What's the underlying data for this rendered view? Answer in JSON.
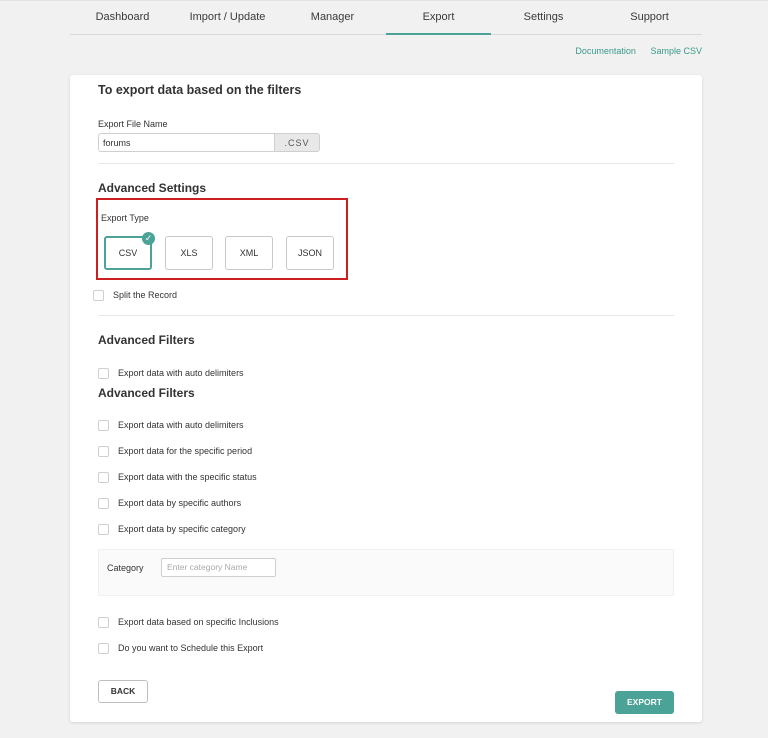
{
  "nav": {
    "tabs": [
      {
        "label": "Dashboard"
      },
      {
        "label": "Import / Update"
      },
      {
        "label": "Manager"
      },
      {
        "label": "Export"
      },
      {
        "label": "Settings"
      },
      {
        "label": "Support"
      }
    ],
    "active_tab": "Export"
  },
  "links": {
    "documentation": "Documentation",
    "sample_csv": "Sample CSV"
  },
  "card": {
    "title": "To export data based on the filters",
    "file_name_label": "Export File Name",
    "file_name_value": "forums",
    "file_ext": ".CSV",
    "advanced_settings_title": "Advanced Settings",
    "export_type_label": "Export Type",
    "export_types": [
      "CSV",
      "XLS",
      "XML",
      "JSON"
    ],
    "selected_type": "CSV",
    "split_record_label": "Split the Record",
    "advanced_filters_title_1": "Advanced Filters",
    "auto_delimiters_1": "Export data with auto delimiters",
    "advanced_filters_title_2": "Advanced Filters",
    "filters": [
      "Export data with auto delimiters",
      "Export data for the specific period",
      "Export data with the specific status",
      "Export data by specific authors",
      "Export data by specific category"
    ],
    "category_label": "Category",
    "category_placeholder": "Enter category Name",
    "inclusions_label": "Export data based on specific Inclusions",
    "schedule_label": "Do you want to Schedule this Export",
    "back_label": "BACK",
    "export_label": "EXPORT"
  },
  "colors": {
    "accent": "#4aa396",
    "highlight": "#cc1f1f"
  }
}
